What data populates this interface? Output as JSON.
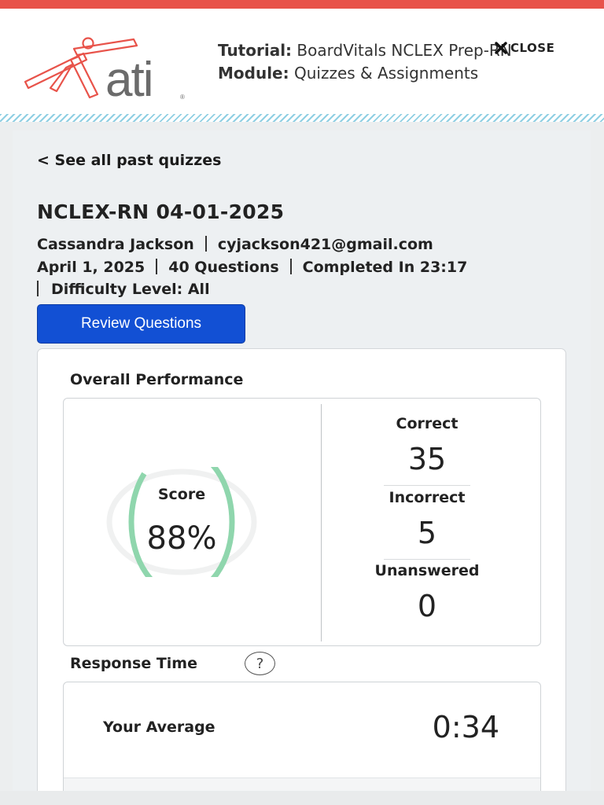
{
  "header": {
    "logo_text": "ati",
    "logo_mark": "®",
    "tutorial_label": "Tutorial:",
    "tutorial_value": "BoardVitals NCLEX Prep-RN",
    "module_label": "Module:",
    "module_value": "Quizzes & Assignments",
    "close_label": "CLOSE",
    "colors": {
      "accent_bar": "#e8534a",
      "logo_red": "#e8534a",
      "logo_gray": "#6b6b6b"
    }
  },
  "nav": {
    "back_link": "< See all past quizzes"
  },
  "quiz": {
    "title": "NCLEX-RN 04-01-2025",
    "student_name": "Cassandra Jackson",
    "student_email": "cyjackson421@gmail.com",
    "date": "April 1, 2025",
    "question_count": "40 Questions",
    "completed": "Completed In 23:17",
    "difficulty": "Difficulty Level: All",
    "review_button": "Review Questions",
    "review_button_color": "#1250d4"
  },
  "overall_performance": {
    "title": "Overall Performance",
    "score_label": "Score",
    "score_value": "88%",
    "score_fraction": 0.88,
    "ring_color": "#8fd6ad",
    "ring_track_color": "#f0f1f1",
    "correct_label": "Correct",
    "correct_value": "35",
    "incorrect_label": "Incorrect",
    "incorrect_value": "5",
    "unanswered_label": "Unanswered",
    "unanswered_value": "0"
  },
  "response_time": {
    "title": "Response Time",
    "help_icon": "question-circle-icon",
    "help_text": "?",
    "your_average_label": "Your Average",
    "your_average_value": "0:34"
  }
}
